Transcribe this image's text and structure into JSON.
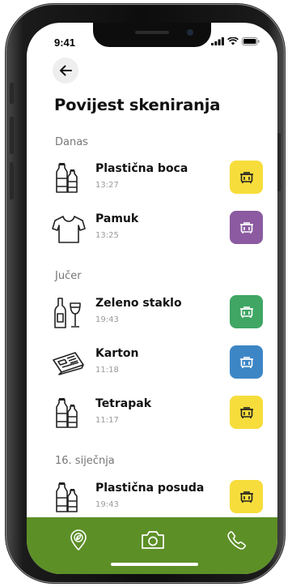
{
  "status_bar": {
    "time": "9:41"
  },
  "header": {
    "title": "Povijest skeniranja"
  },
  "colors": {
    "yellow_bin": "#f7dd3b",
    "purple_bin": "#8b5aa0",
    "green_bin": "#3fa664",
    "blue_bin": "#3d86c6",
    "bottom_bar": "#5d8f27"
  },
  "sections": [
    {
      "label": "Danas",
      "items": [
        {
          "name": "Plastična boca",
          "time": "13:27",
          "icon": "plastic-bottles-icon",
          "bin": "yellow"
        },
        {
          "name": "Pamuk",
          "time": "13:25",
          "icon": "tshirt-icon",
          "bin": "purple"
        }
      ]
    },
    {
      "label": "Jučer",
      "items": [
        {
          "name": "Zeleno staklo",
          "time": "19:43",
          "icon": "wine-bottle-glass-icon",
          "bin": "green"
        },
        {
          "name": "Karton",
          "time": "11:18",
          "icon": "newspaper-icon",
          "bin": "blue"
        },
        {
          "name": "Tetrapak",
          "time": "11:17",
          "icon": "plastic-bottles-icon",
          "bin": "yellow"
        }
      ]
    },
    {
      "label": "16. siječnja",
      "items": [
        {
          "name": "Plastična posuda",
          "time": "19:43",
          "icon": "plastic-bottles-icon",
          "bin": "yellow"
        }
      ]
    }
  ],
  "bottom_nav": [
    {
      "icon": "location-leaf-icon"
    },
    {
      "icon": "camera-icon"
    },
    {
      "icon": "phone-icon"
    }
  ]
}
